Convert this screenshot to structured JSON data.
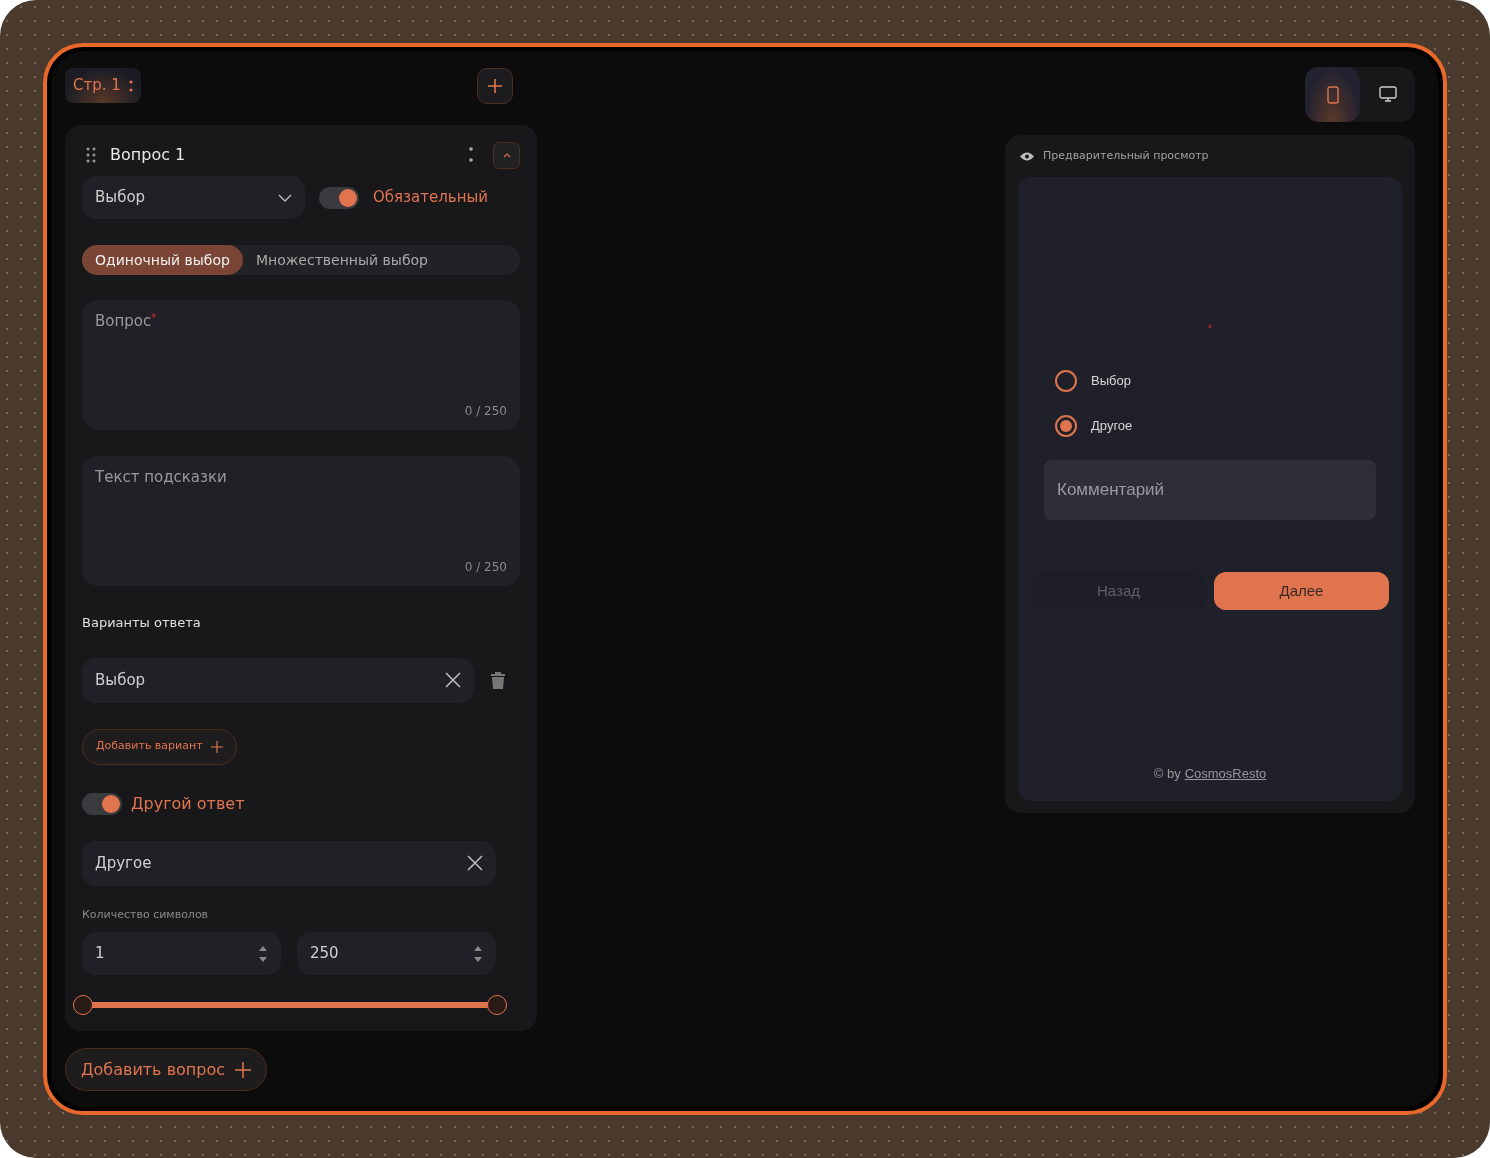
{
  "page_tab": {
    "label": "Стр. 1"
  },
  "question": {
    "title": "Вопрос 1",
    "expanded": true,
    "type_select": "Выбор",
    "required": {
      "label": "Обязательный",
      "on": true
    },
    "modes": [
      {
        "label": "Одиночный выбор",
        "selected": true
      },
      {
        "label": "Множественный выбор",
        "selected": false
      }
    ],
    "question_field": {
      "placeholder": "Вопрос",
      "required_mark": "*",
      "counter": "0 / 250"
    },
    "hint_field": {
      "placeholder": "Текст подсказки",
      "counter": "0 / 250"
    },
    "options_heading": "Варианты ответа",
    "options": [
      {
        "value": "Выбор"
      }
    ],
    "add_option": "Добавить вариант",
    "other": {
      "label": "Другой ответ",
      "on": true,
      "value": "Другое"
    },
    "length": {
      "label": "Количество символов",
      "min": "1",
      "max": "250",
      "range_start": {
        "level": 0
      },
      "range_end": {
        "level": 1
      }
    }
  },
  "add_question": "Добавить вопрос",
  "devices": [
    {
      "kind": "phone",
      "selected": true
    },
    {
      "kind": "desktop",
      "selected": false
    }
  ],
  "preview": {
    "title": "Предварительный просмотр",
    "required_mark": "*",
    "choices": [
      {
        "label": "Выбор",
        "selected": false
      },
      {
        "label": "Другое",
        "selected": true
      }
    ],
    "comment_placeholder": "Комментарий",
    "back": "Назад",
    "next": "Далее",
    "footer_prefix": "© by",
    "footer_link": "CosmosResto"
  }
}
